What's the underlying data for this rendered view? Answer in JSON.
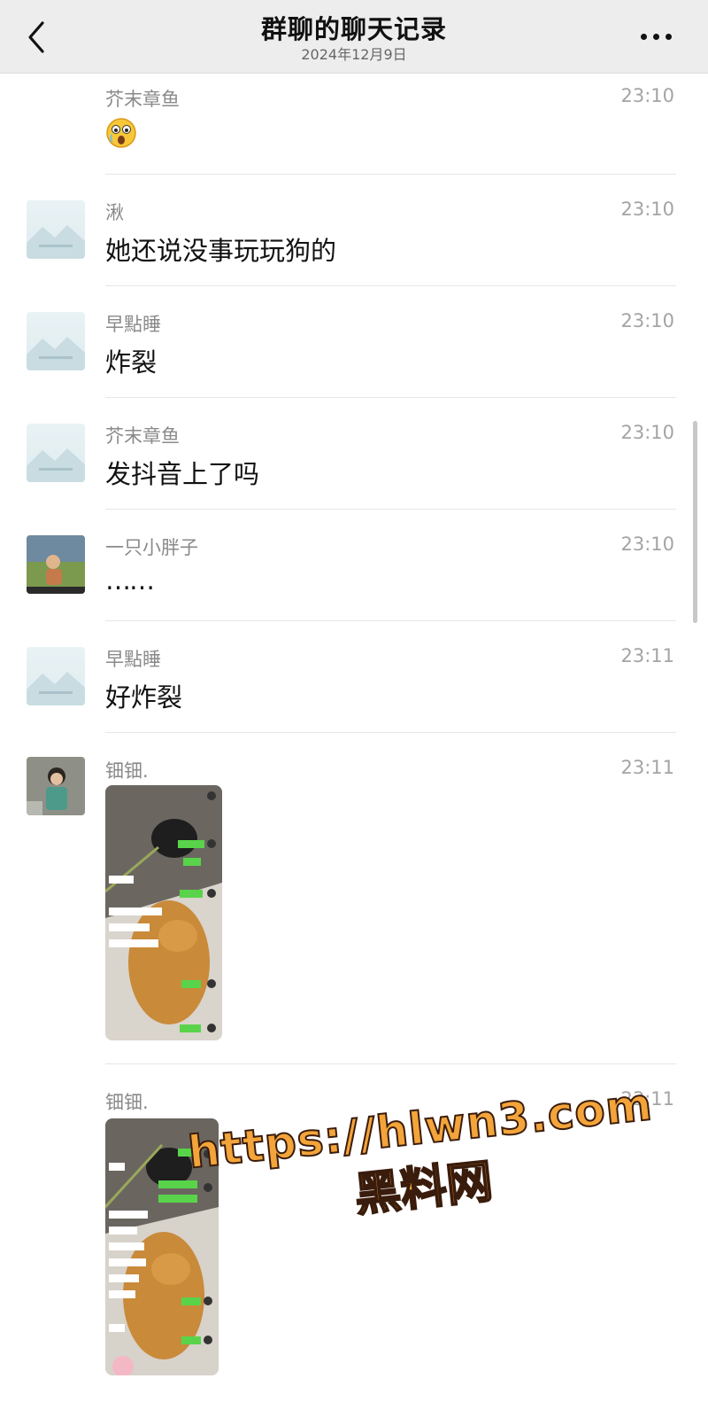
{
  "header": {
    "title": "群聊的聊天记录",
    "date": "2024年12月9日"
  },
  "messages": [
    {
      "sender": "芥末章鱼",
      "time": "23:10",
      "text": "",
      "type": "emoji",
      "emoji": "😲"
    },
    {
      "sender": "湫",
      "time": "23:10",
      "text": "她还说没事玩玩狗的",
      "type": "text"
    },
    {
      "sender": "早點睡",
      "time": "23:10",
      "text": "炸裂",
      "type": "text"
    },
    {
      "sender": "芥末章鱼",
      "time": "23:10",
      "text": "发抖音上了吗",
      "type": "text"
    },
    {
      "sender": "一只小胖子",
      "time": "23:10",
      "text": "……",
      "type": "text"
    },
    {
      "sender": "早點睡",
      "time": "23:11",
      "text": "好炸裂",
      "type": "text"
    },
    {
      "sender": "钿钿.",
      "time": "23:11",
      "text": "",
      "type": "image"
    },
    {
      "sender": "钿钿.",
      "time": "23:11",
      "text": "",
      "type": "image"
    }
  ],
  "watermark": {
    "url": "https://hlwn3.com",
    "name": "黑料网"
  },
  "colors": {
    "navbar": "#ededed",
    "chat_green": "#59d44a",
    "watermark": "#f3a43a"
  }
}
